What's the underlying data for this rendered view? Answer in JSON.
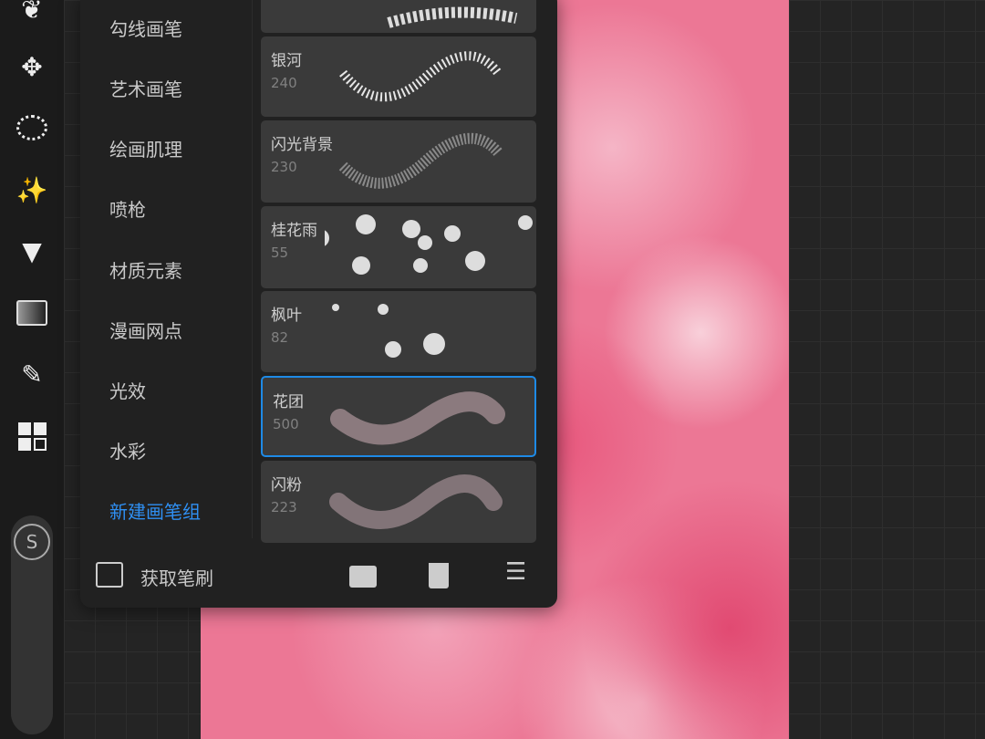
{
  "toolbar": {
    "tools": [
      "brush-leaf-icon",
      "transform-icon",
      "selection-icon",
      "adjustments-icon",
      "fill-icon",
      "gradient-icon",
      "eyedropper-icon",
      "layout-icon"
    ],
    "s_label": "S"
  },
  "categories": [
    "勾线画笔",
    "艺术画笔",
    "绘画肌理",
    "喷枪",
    "材质元素",
    "漫画网点",
    "光效",
    "水彩",
    "新建画笔组"
  ],
  "brushes": [
    {
      "name": "银河",
      "count": "240"
    },
    {
      "name": "闪光背景",
      "count": "230"
    },
    {
      "name": "桂花雨",
      "count": "55"
    },
    {
      "name": "枫叶",
      "count": "82"
    },
    {
      "name": "花团",
      "count": "500",
      "selected": true
    },
    {
      "name": "闪粉",
      "count": "223"
    }
  ],
  "footer": {
    "get_brushes": "获取笔刷"
  },
  "colors": {
    "accent": "#2f8ff2",
    "canvas": "#ec7795"
  }
}
